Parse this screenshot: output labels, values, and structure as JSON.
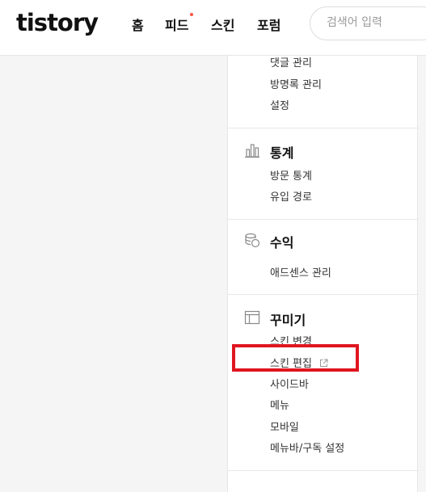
{
  "header": {
    "logo": "tistory",
    "nav": [
      "홈",
      "피드",
      "스킨",
      "포럼"
    ],
    "search_placeholder": "검색어 입력"
  },
  "sidebar": {
    "top_items": [
      "댓글 관리",
      "방명록 관리",
      "설정"
    ],
    "stats": {
      "title": "통계",
      "icon": "bar-chart-icon",
      "items": [
        "방문 통계",
        "유입 경로"
      ]
    },
    "revenue": {
      "title": "수익",
      "icon": "coins-icon",
      "items": [
        "애드센스 관리"
      ]
    },
    "decorate": {
      "title": "꾸미기",
      "icon": "layout-icon",
      "items": [
        "스킨 변경",
        "스킨 편집",
        "사이드바",
        "메뉴",
        "모바일",
        "메뉴바/구독 설정"
      ]
    }
  },
  "colors": {
    "highlight": "#e0161f",
    "feed_dot": "#ff5544"
  }
}
